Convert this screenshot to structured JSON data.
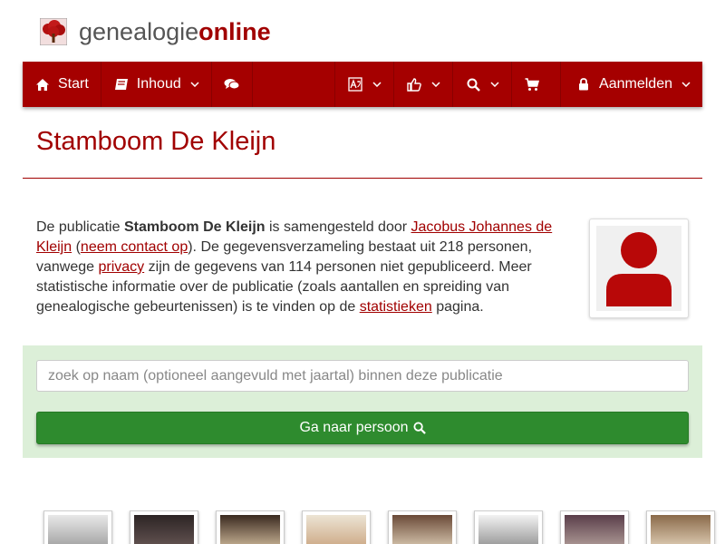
{
  "brand": {
    "name_plain": "genealogie",
    "name_bold": "online"
  },
  "colors": {
    "accent": "#a50000",
    "panel": "#dcefd8",
    "button": "#2e8b2e"
  },
  "nav": {
    "start_label": "Start",
    "inhoud_label": "Inhoud",
    "aanmelden_label": "Aanmelden",
    "icons": [
      "home-icon",
      "book-icon",
      "chat-icon",
      "translate-icon",
      "thumbs-up-icon",
      "search-icon",
      "cart-icon",
      "lock-icon"
    ]
  },
  "page": {
    "title": "Stamboom De Kleijn"
  },
  "intro": {
    "t1": "De publicatie ",
    "pub_name": "Stamboom De Kleijn",
    "t2": " is samengesteld door ",
    "author_link": "Jacobus Johannes de Kleijn",
    "t3": " (",
    "contact_link": "neem contact op",
    "t4": "). De gegevensverzameling bestaat uit 218 personen, vanwege ",
    "privacy_link": "privacy",
    "t5": " zijn de gegevens van 114 personen niet gepubliceerd. Meer statistische informatie over de publicatie (zoals aantallen en spreiding van genealogische gebeurtenissen) is te vinden op de ",
    "stats_link": "statistieken",
    "t6": " pagina."
  },
  "search": {
    "placeholder": "zoek op naam (optioneel aangevuld met jaartal) binnen deze publicatie",
    "value": "",
    "button_label": "Ga naar persoon"
  }
}
